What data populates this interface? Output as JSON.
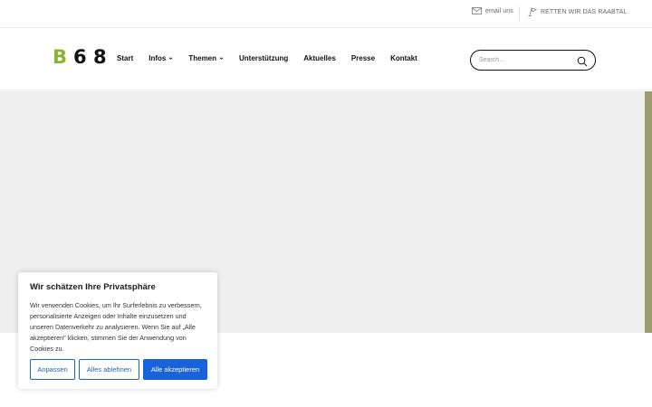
{
  "topbar": {
    "email_label": "email uns",
    "email_icon": "envelope-icon",
    "rescue_label": "RETTEN WIR DAS RAABTAL",
    "rescue_icon": "flag-icon"
  },
  "header": {
    "logo": {
      "letter_b": "B",
      "digits": "6 8"
    },
    "nav": [
      {
        "label": "Start",
        "has_dropdown": false
      },
      {
        "label": "Infos",
        "has_dropdown": true
      },
      {
        "label": "Themen",
        "has_dropdown": true
      },
      {
        "label": "Unterstützung",
        "has_dropdown": false
      },
      {
        "label": "Aktuelles",
        "has_dropdown": false
      },
      {
        "label": "Presse",
        "has_dropdown": false
      },
      {
        "label": "Kontakt",
        "has_dropdown": false
      }
    ],
    "search": {
      "placeholder": "Search...",
      "icon": "search-icon"
    }
  },
  "cookie_banner": {
    "title": "Wir schätzen Ihre Privatsphäre",
    "text": "Wir verwenden Cookies, um Ihr Surferlebnis zu verbessern, personalisierte Anzeigen oder Inhalte einzusetzen und unseren Datenverkehr zu analysieren. Wenn Sie auf „Alle akzeptieren\" klicken, stimmen Sie der Anwendung von Cookies zu.",
    "buttons": {
      "customize": "Anpassen",
      "reject": "Alles ablehnen",
      "accept": "Alle akzeptieren"
    }
  },
  "colors": {
    "brand_green": "#8cb32f",
    "cookie_blue": "#1863dc",
    "hero_bg": "#efefef",
    "scrollbar": "#9b9b6f"
  }
}
